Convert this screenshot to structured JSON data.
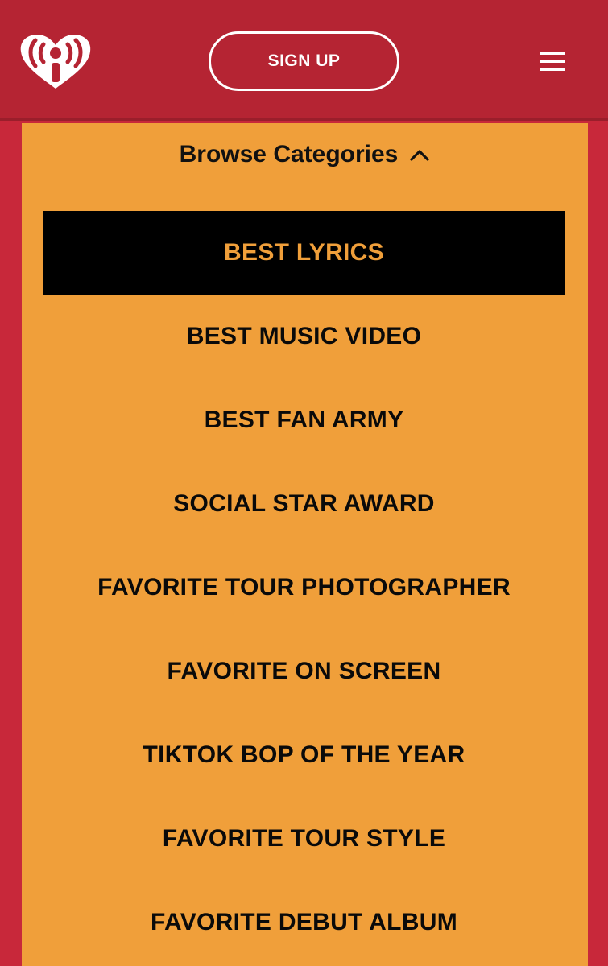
{
  "header": {
    "logo_icon": "iheartradio-logo-icon",
    "signup_label": "SIGN UP",
    "menu_icon": "hamburger-menu-icon"
  },
  "browse": {
    "label": "Browse Categories",
    "toggle_icon": "chevron-up-icon"
  },
  "categories": [
    {
      "label": "BEST LYRICS",
      "active": true
    },
    {
      "label": "BEST MUSIC VIDEO",
      "active": false
    },
    {
      "label": "BEST FAN ARMY",
      "active": false
    },
    {
      "label": "SOCIAL STAR AWARD",
      "active": false
    },
    {
      "label": "FAVORITE TOUR PHOTOGRAPHER",
      "active": false
    },
    {
      "label": "FAVORITE ON SCREEN",
      "active": false
    },
    {
      "label": "TIKTOK BOP OF THE YEAR",
      "active": false
    },
    {
      "label": "FAVORITE TOUR STYLE",
      "active": false
    },
    {
      "label": "FAVORITE DEBUT ALBUM",
      "active": false
    }
  ],
  "colors": {
    "header_bg": "#b52433",
    "page_bg": "#c8283a",
    "panel_bg": "#f09f3a",
    "active_bg": "#000000",
    "text": "#0a0a0a",
    "white": "#ffffff"
  }
}
